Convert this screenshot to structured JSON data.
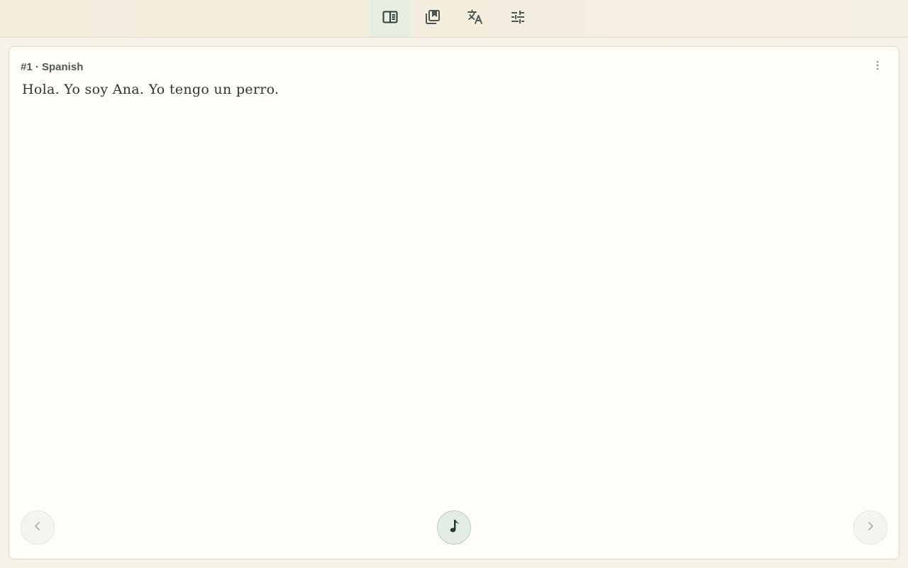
{
  "topbar": {
    "tabs": [
      {
        "icon": "reader-icon",
        "active": true
      },
      {
        "icon": "bookmarks-icon",
        "active": false
      },
      {
        "icon": "translate-icon",
        "active": false
      },
      {
        "icon": "sliders-icon",
        "active": false
      }
    ]
  },
  "card": {
    "header": "#1 · Spanish",
    "text": "Hola. Yo soy Ana. Yo tengo un perro."
  },
  "controls": {
    "prev_icon": "chevron-left-icon",
    "next_icon": "chevron-right-icon",
    "audio_icon": "music-note-icon"
  },
  "colors": {
    "accent": "#2f3f37",
    "active_tab_bg": "#e6eee3"
  }
}
